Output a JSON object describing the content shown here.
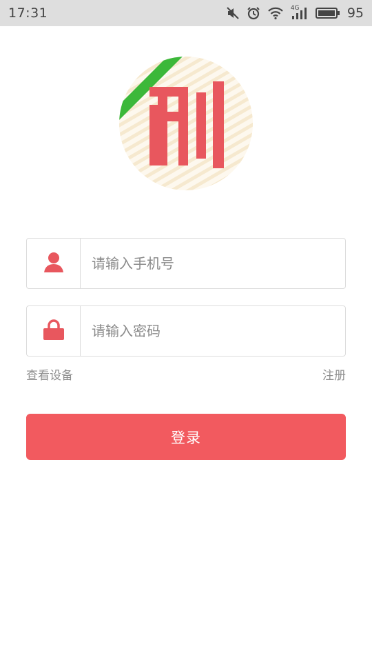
{
  "status_bar": {
    "time": "17:31",
    "network_label": "4G",
    "battery_level": "95",
    "icons": [
      "mute-icon",
      "alarm-icon",
      "wifi-icon",
      "signal-icon",
      "battery-icon"
    ]
  },
  "logo": {
    "glyph": "利",
    "colors": {
      "primary": "#e8575e",
      "ribbon": "#3cb83a"
    }
  },
  "login_form": {
    "phone_placeholder": "请输入手机号",
    "password_placeholder": "请输入密码",
    "view_device_link": "查看设备",
    "register_link": "注册",
    "login_button": "登录"
  },
  "colors": {
    "accent": "#f25a5f",
    "icon": "#e8575e",
    "border": "#dcdcdc",
    "muted_text": "#8e8e8e"
  }
}
